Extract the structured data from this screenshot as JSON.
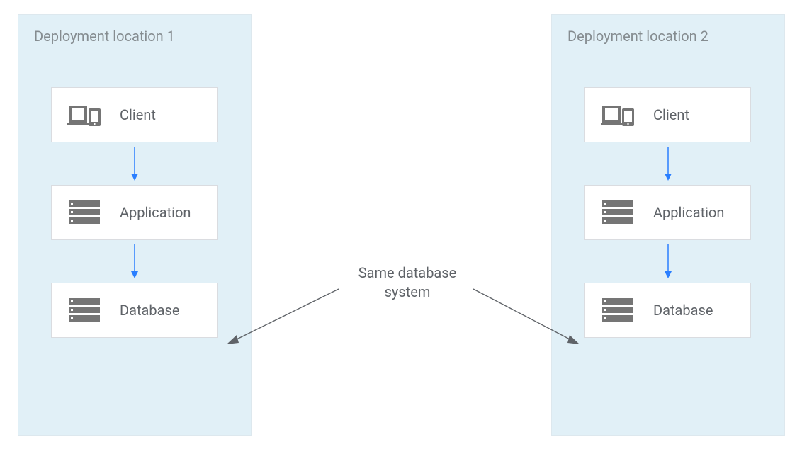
{
  "locations": [
    {
      "title": "Deployment location 1",
      "tiers": [
        {
          "icon": "device-icon",
          "label": "Client"
        },
        {
          "icon": "server-icon",
          "label": "Application"
        },
        {
          "icon": "server-icon",
          "label": "Database"
        }
      ]
    },
    {
      "title": "Deployment location 2",
      "tiers": [
        {
          "icon": "device-icon",
          "label": "Client"
        },
        {
          "icon": "server-icon",
          "label": "Application"
        },
        {
          "icon": "server-icon",
          "label": "Database"
        }
      ]
    }
  ],
  "center_annotation": "Same database\nsystem",
  "colors": {
    "location_bg": "#e1f0f7",
    "box_border": "#dadce0",
    "text_muted": "#858c90",
    "text_body": "#5f6368",
    "icon_fill": "#757575",
    "flow_arrow": "#2a7fff",
    "annotation_arrow": "#5f6368"
  }
}
